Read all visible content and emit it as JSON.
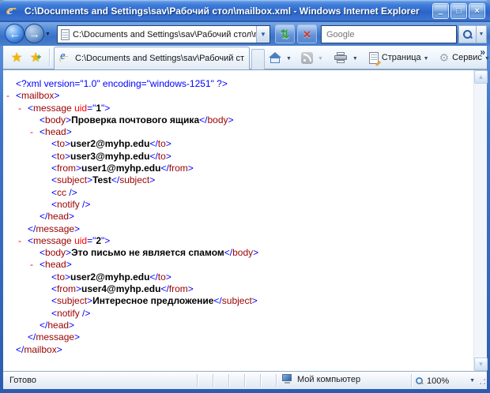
{
  "window": {
    "title": "C:\\Documents and Settings\\sav\\Рабочий стол\\mailbox.xml - Windows Internet Explorer",
    "minimize_glyph": "–",
    "maximize_glyph": "□",
    "close_glyph": "×"
  },
  "icons": {
    "dropdown": "▼",
    "back": "←",
    "forward": "→",
    "refresh": "⇅",
    "stop": "×",
    "star": "★",
    "star_plus": "+",
    "overflow": "»",
    "scroll_up": "▲",
    "scroll_down": "▼"
  },
  "navbar": {
    "address": "C:\\Documents and Settings\\sav\\Рабочий стол\\mai",
    "search_placeholder": "Google"
  },
  "tabbar": {
    "tab_title": "C:\\Documents and Settings\\sav\\Рабочий ст...",
    "page_button": "Страница",
    "tools_button": "Сервис"
  },
  "statusbar": {
    "status": "Готово",
    "zone": "Мой компьютер",
    "zoom_level": "100%"
  },
  "colors": {
    "markup": "#0000ff",
    "element": "#990000",
    "attribute": "#ff0000",
    "text": "#000000",
    "marker": "#ff0000",
    "titlebar_blue": "#2B64C6",
    "content_bg": "#ffffff"
  },
  "content": {
    "marker_glyph": "-",
    "xml_lines": [
      {
        "indent": 0,
        "marker": false,
        "segments": [
          [
            "m",
            "<?xml version=\"1.0\" encoding=\"windows-1251\" ?>"
          ]
        ]
      },
      {
        "indent": 0,
        "marker": true,
        "segments": [
          [
            "m",
            "<"
          ],
          [
            "t",
            "mailbox"
          ],
          [
            "m",
            ">"
          ]
        ]
      },
      {
        "indent": 1,
        "marker": true,
        "segments": [
          [
            "m",
            "<"
          ],
          [
            "t",
            "message"
          ],
          [
            "m",
            " "
          ],
          [
            "at",
            "uid"
          ],
          [
            "m",
            "=\""
          ],
          [
            "av",
            "1"
          ],
          [
            "m",
            "\">"
          ]
        ]
      },
      {
        "indent": 2,
        "marker": false,
        "segments": [
          [
            "m",
            "<"
          ],
          [
            "t",
            "body"
          ],
          [
            "m",
            ">"
          ],
          [
            "tx",
            "Проверка почтового ящика"
          ],
          [
            "m",
            "</"
          ],
          [
            "t",
            "body"
          ],
          [
            "m",
            ">"
          ]
        ]
      },
      {
        "indent": 2,
        "marker": true,
        "segments": [
          [
            "m",
            "<"
          ],
          [
            "t",
            "head"
          ],
          [
            "m",
            ">"
          ]
        ]
      },
      {
        "indent": 3,
        "marker": false,
        "segments": [
          [
            "m",
            "<"
          ],
          [
            "t",
            "to"
          ],
          [
            "m",
            ">"
          ],
          [
            "tx",
            "user2@myhp.edu"
          ],
          [
            "m",
            "</"
          ],
          [
            "t",
            "to"
          ],
          [
            "m",
            ">"
          ]
        ]
      },
      {
        "indent": 3,
        "marker": false,
        "segments": [
          [
            "m",
            "<"
          ],
          [
            "t",
            "to"
          ],
          [
            "m",
            ">"
          ],
          [
            "tx",
            "user3@myhp.edu"
          ],
          [
            "m",
            "</"
          ],
          [
            "t",
            "to"
          ],
          [
            "m",
            ">"
          ]
        ]
      },
      {
        "indent": 3,
        "marker": false,
        "segments": [
          [
            "m",
            "<"
          ],
          [
            "t",
            "from"
          ],
          [
            "m",
            ">"
          ],
          [
            "tx",
            "user1@myhp.edu"
          ],
          [
            "m",
            "</"
          ],
          [
            "t",
            "from"
          ],
          [
            "m",
            ">"
          ]
        ]
      },
      {
        "indent": 3,
        "marker": false,
        "segments": [
          [
            "m",
            "<"
          ],
          [
            "t",
            "subject"
          ],
          [
            "m",
            ">"
          ],
          [
            "tx",
            "Test"
          ],
          [
            "m",
            "</"
          ],
          [
            "t",
            "subject"
          ],
          [
            "m",
            ">"
          ]
        ]
      },
      {
        "indent": 3,
        "marker": false,
        "segments": [
          [
            "m",
            "<"
          ],
          [
            "t",
            "cc"
          ],
          [
            "m",
            " />"
          ]
        ]
      },
      {
        "indent": 3,
        "marker": false,
        "segments": [
          [
            "m",
            "<"
          ],
          [
            "t",
            "notify"
          ],
          [
            "m",
            " />"
          ]
        ]
      },
      {
        "indent": 2,
        "marker": false,
        "segments": [
          [
            "m",
            "</"
          ],
          [
            "t",
            "head"
          ],
          [
            "m",
            ">"
          ]
        ]
      },
      {
        "indent": 1,
        "marker": false,
        "segments": [
          [
            "m",
            "</"
          ],
          [
            "t",
            "message"
          ],
          [
            "m",
            ">"
          ]
        ]
      },
      {
        "indent": 1,
        "marker": true,
        "segments": [
          [
            "m",
            "<"
          ],
          [
            "t",
            "message"
          ],
          [
            "m",
            " "
          ],
          [
            "at",
            "uid"
          ],
          [
            "m",
            "=\""
          ],
          [
            "av",
            "2"
          ],
          [
            "m",
            "\">"
          ]
        ]
      },
      {
        "indent": 2,
        "marker": false,
        "segments": [
          [
            "m",
            "<"
          ],
          [
            "t",
            "body"
          ],
          [
            "m",
            ">"
          ],
          [
            "tx",
            "Это письмо не является спамом"
          ],
          [
            "m",
            "</"
          ],
          [
            "t",
            "body"
          ],
          [
            "m",
            ">"
          ]
        ]
      },
      {
        "indent": 2,
        "marker": true,
        "segments": [
          [
            "m",
            "<"
          ],
          [
            "t",
            "head"
          ],
          [
            "m",
            ">"
          ]
        ]
      },
      {
        "indent": 3,
        "marker": false,
        "segments": [
          [
            "m",
            "<"
          ],
          [
            "t",
            "to"
          ],
          [
            "m",
            ">"
          ],
          [
            "tx",
            "user2@myhp.edu"
          ],
          [
            "m",
            "</"
          ],
          [
            "t",
            "to"
          ],
          [
            "m",
            ">"
          ]
        ]
      },
      {
        "indent": 3,
        "marker": false,
        "segments": [
          [
            "m",
            "<"
          ],
          [
            "t",
            "from"
          ],
          [
            "m",
            ">"
          ],
          [
            "tx",
            "user4@myhp.edu"
          ],
          [
            "m",
            "</"
          ],
          [
            "t",
            "from"
          ],
          [
            "m",
            ">"
          ]
        ]
      },
      {
        "indent": 3,
        "marker": false,
        "segments": [
          [
            "m",
            "<"
          ],
          [
            "t",
            "subject"
          ],
          [
            "m",
            ">"
          ],
          [
            "tx",
            "Интересное предложение"
          ],
          [
            "m",
            "</"
          ],
          [
            "t",
            "subject"
          ],
          [
            "m",
            ">"
          ]
        ]
      },
      {
        "indent": 3,
        "marker": false,
        "segments": [
          [
            "m",
            "<"
          ],
          [
            "t",
            "notify"
          ],
          [
            "m",
            " />"
          ]
        ]
      },
      {
        "indent": 2,
        "marker": false,
        "segments": [
          [
            "m",
            "</"
          ],
          [
            "t",
            "head"
          ],
          [
            "m",
            ">"
          ]
        ]
      },
      {
        "indent": 1,
        "marker": false,
        "segments": [
          [
            "m",
            "</"
          ],
          [
            "t",
            "message"
          ],
          [
            "m",
            ">"
          ]
        ]
      },
      {
        "indent": 0,
        "marker": false,
        "segments": [
          [
            "m",
            "</"
          ],
          [
            "t",
            "mailbox"
          ],
          [
            "m",
            ">"
          ]
        ]
      }
    ]
  }
}
